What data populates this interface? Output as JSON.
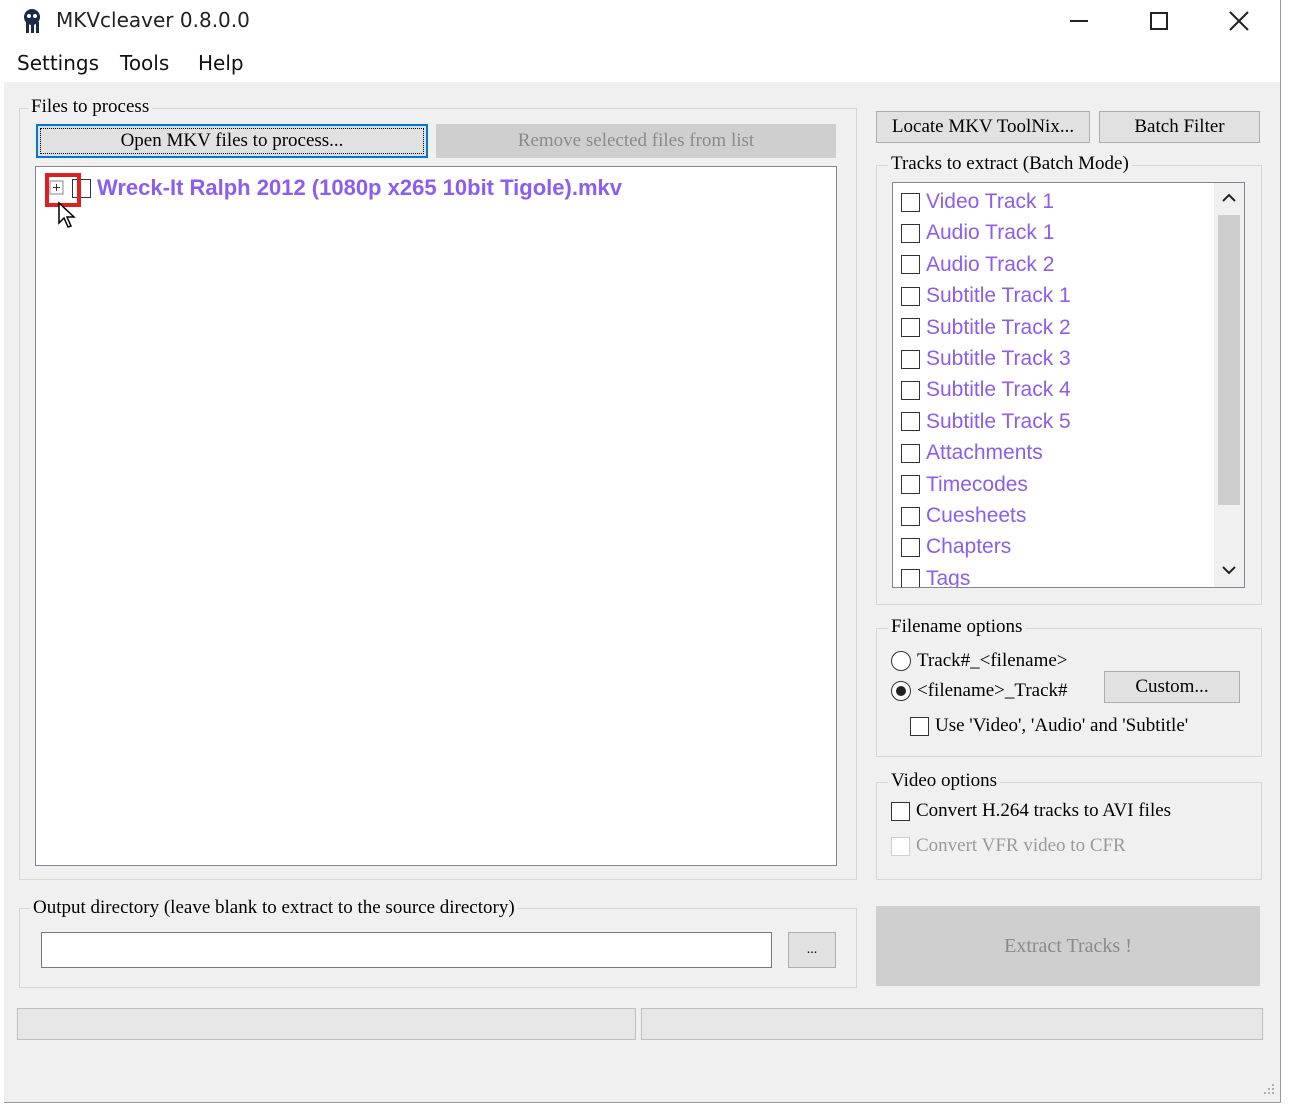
{
  "window": {
    "title": "MKVcleaver 0.8.0.0"
  },
  "menu": [
    "Settings",
    "Tools",
    "Help"
  ],
  "files": {
    "group_label": "Files to process",
    "open_button": "Open MKV files to process...",
    "remove_button": "Remove selected files from list",
    "items": [
      {
        "name": "Wreck-It Ralph 2012 (1080p x265 10bit Tigole).mkv"
      }
    ]
  },
  "top_buttons": {
    "locate": "Locate MKV ToolNix...",
    "batch": "Batch Filter"
  },
  "tracks": {
    "group_label": "Tracks to extract (Batch Mode)",
    "items": [
      "Video Track 1",
      "Audio Track 1",
      "Audio Track 2",
      "Subtitle Track 1",
      "Subtitle Track 2",
      "Subtitle Track 3",
      "Subtitle Track 4",
      "Subtitle Track 5",
      "Attachments",
      "Timecodes",
      "Cuesheets",
      "Chapters",
      "Tags"
    ]
  },
  "filename_options": {
    "group_label": "Filename options",
    "option1": "Track#_<filename>",
    "option2": "<filename>_Track#",
    "selected": 2,
    "custom_button": "Custom...",
    "use_names": "Use 'Video', 'Audio' and 'Subtitle'"
  },
  "video_options": {
    "group_label": "Video options",
    "convert_avi": "Convert H.264 tracks to AVI files",
    "convert_cfr": "Convert VFR video to CFR"
  },
  "output": {
    "group_label": "Output directory (leave blank to extract to the source directory)",
    "value": "",
    "browse_button": "..."
  },
  "extract_button": "Extract Tracks !",
  "colors": {
    "track_text": "#8b5cf6",
    "highlight": "#e02020",
    "focus": "#0078d7"
  }
}
